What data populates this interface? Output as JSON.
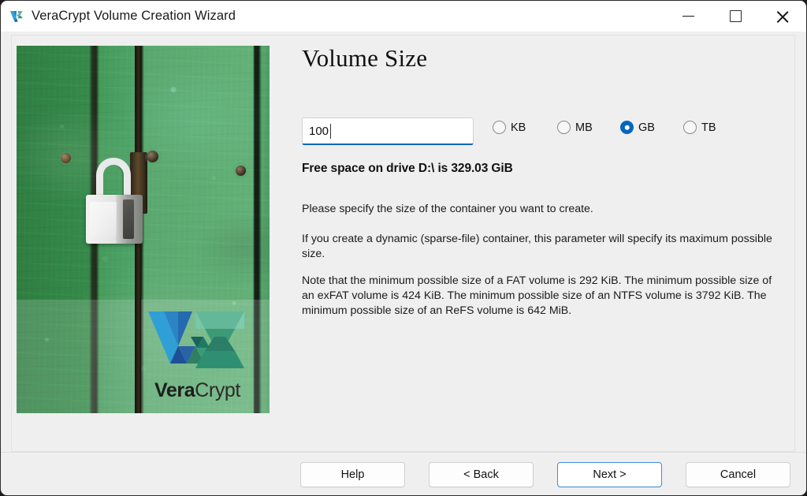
{
  "window": {
    "title": "VeraCrypt Volume Creation Wizard",
    "icon": "veracrypt-logo-icon",
    "controls": {
      "minimize": "minimize-icon",
      "maximize": "maximize-icon",
      "close": "close-icon"
    }
  },
  "banner": {
    "image_description": "green painted wooden door with white padlock",
    "logo": {
      "brand_bold": "Vera",
      "brand_light": "Crypt",
      "mark_colors": {
        "v_blue_light": "#2f9fd6",
        "v_blue_dark": "#1f4f96",
        "c_green_light": "#63b89a",
        "c_green_dark": "#18635a"
      }
    }
  },
  "main": {
    "title": "Volume Size",
    "size_field": {
      "value": "100",
      "placeholder": ""
    },
    "units": [
      {
        "label": "KB",
        "selected": false
      },
      {
        "label": "MB",
        "selected": false
      },
      {
        "label": "GB",
        "selected": true
      },
      {
        "label": "TB",
        "selected": false
      }
    ],
    "free_space": "Free space on drive D:\\ is 329.03 GiB",
    "paragraphs": {
      "p1": "Please specify the size of the container you want to create.",
      "p2": "If you create a dynamic (sparse-file) container, this parameter will specify its maximum possible size.",
      "p3": "Note that the minimum possible size of a FAT volume is 292 KiB. The minimum possible size of an exFAT volume is 424 KiB. The minimum possible size of an NTFS volume is 3792 KiB. The minimum possible size of an ReFS volume is 642 MiB."
    }
  },
  "footer": {
    "help": "Help",
    "back": "< Back",
    "next": "Next >",
    "cancel": "Cancel"
  },
  "colors": {
    "accent": "#0067c0",
    "default_button_border": "#3e8fd6",
    "window_bg": "#efefef",
    "titlebar_bg": "#ffffff"
  }
}
